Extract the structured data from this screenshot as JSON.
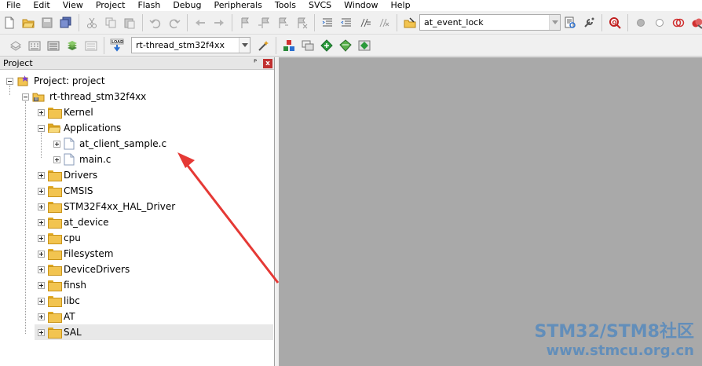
{
  "menu": [
    "File",
    "Edit",
    "View",
    "Project",
    "Flash",
    "Debug",
    "Peripherals",
    "Tools",
    "SVCS",
    "Window",
    "Help"
  ],
  "toolbar1": {
    "find_combo_value": "at_event_lock"
  },
  "toolbar2": {
    "load_icon_text": "LOAD",
    "target_combo_value": "rt-thread_stm32f4xx"
  },
  "project_panel": {
    "title": "Project",
    "pin_glyph": "ᴾ",
    "close_glyph": "x",
    "root_label": "Project: project",
    "target_label": "rt-thread_stm32f4xx",
    "groups": [
      {
        "label": "Kernel",
        "expanded": false
      },
      {
        "label": "Applications",
        "expanded": true,
        "files": [
          "at_client_sample.c",
          "main.c"
        ]
      },
      {
        "label": "Drivers",
        "expanded": false
      },
      {
        "label": "CMSIS",
        "expanded": false
      },
      {
        "label": "STM32F4xx_HAL_Driver",
        "expanded": false
      },
      {
        "label": "at_device",
        "expanded": false
      },
      {
        "label": "cpu",
        "expanded": false
      },
      {
        "label": "Filesystem",
        "expanded": false
      },
      {
        "label": "DeviceDrivers",
        "expanded": false
      },
      {
        "label": "finsh",
        "expanded": false
      },
      {
        "label": "libc",
        "expanded": false
      },
      {
        "label": "AT",
        "expanded": false
      },
      {
        "label": "SAL",
        "expanded": false,
        "selected": true
      }
    ]
  },
  "watermark": {
    "line1": "STM32/STM8社区",
    "line2": "www.stmcu.org.cn"
  },
  "colors": {
    "editor_bg": "#a9a9a9",
    "arrow": "#e53935",
    "watermark": "#2878c8"
  }
}
